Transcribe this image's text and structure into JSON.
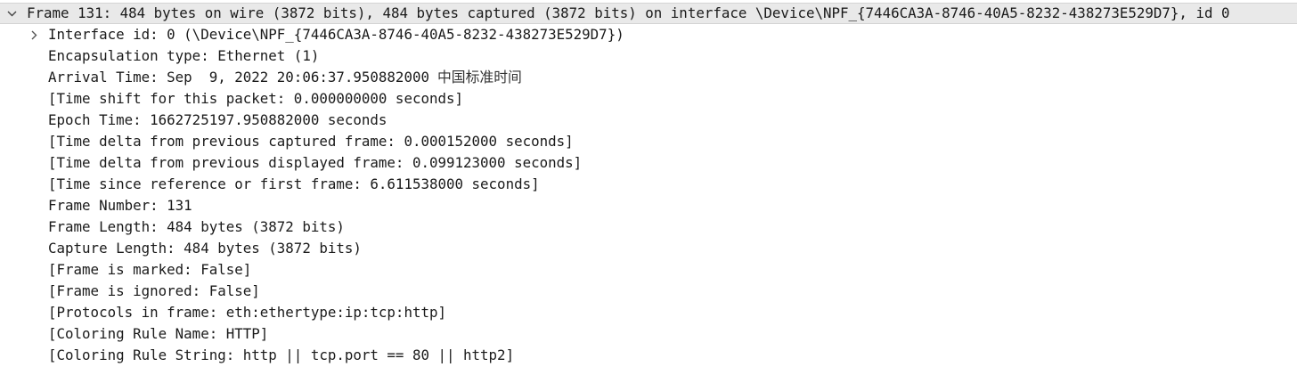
{
  "frame_header": "Frame 131: 484 bytes on wire (3872 bits), 484 bytes captured (3872 bits) on interface \\Device\\NPF_{7446CA3A-8746-40A5-8232-438273E529D7}, id 0",
  "fields": [
    {
      "id": "interface-id",
      "text": "Interface id: 0 (\\Device\\NPF_{7446CA3A-8746-40A5-8232-438273E529D7})",
      "expandable": true
    },
    {
      "id": "encapsulation-type",
      "text": "Encapsulation type: Ethernet (1)"
    },
    {
      "id": "arrival-time",
      "text": "Arrival Time: Sep  9, 2022 20:06:37.950882000 ",
      "suffix": "中国标准时间"
    },
    {
      "id": "time-shift",
      "text": "[Time shift for this packet: 0.000000000 seconds]"
    },
    {
      "id": "epoch-time",
      "text": "Epoch Time: 1662725197.950882000 seconds"
    },
    {
      "id": "time-delta-captured",
      "text": "[Time delta from previous captured frame: 0.000152000 seconds]"
    },
    {
      "id": "time-delta-displayed",
      "text": "[Time delta from previous displayed frame: 0.099123000 seconds]"
    },
    {
      "id": "time-since-reference",
      "text": "[Time since reference or first frame: 6.611538000 seconds]"
    },
    {
      "id": "frame-number",
      "text": "Frame Number: 131"
    },
    {
      "id": "frame-length",
      "text": "Frame Length: 484 bytes (3872 bits)"
    },
    {
      "id": "capture-length",
      "text": "Capture Length: 484 bytes (3872 bits)"
    },
    {
      "id": "frame-marked",
      "text": "[Frame is marked: False]"
    },
    {
      "id": "frame-ignored",
      "text": "[Frame is ignored: False]"
    },
    {
      "id": "protocols-in-frame",
      "text": "[Protocols in frame: eth:ethertype:ip:tcp:http]"
    },
    {
      "id": "coloring-rule-name",
      "text": "[Coloring Rule Name: HTTP]"
    },
    {
      "id": "coloring-rule-string",
      "text": "[Coloring Rule String: http || tcp.port == 80 || http2]"
    }
  ],
  "icons": {
    "expanded": "chevron-down-icon",
    "collapsed": "chevron-right-icon"
  }
}
